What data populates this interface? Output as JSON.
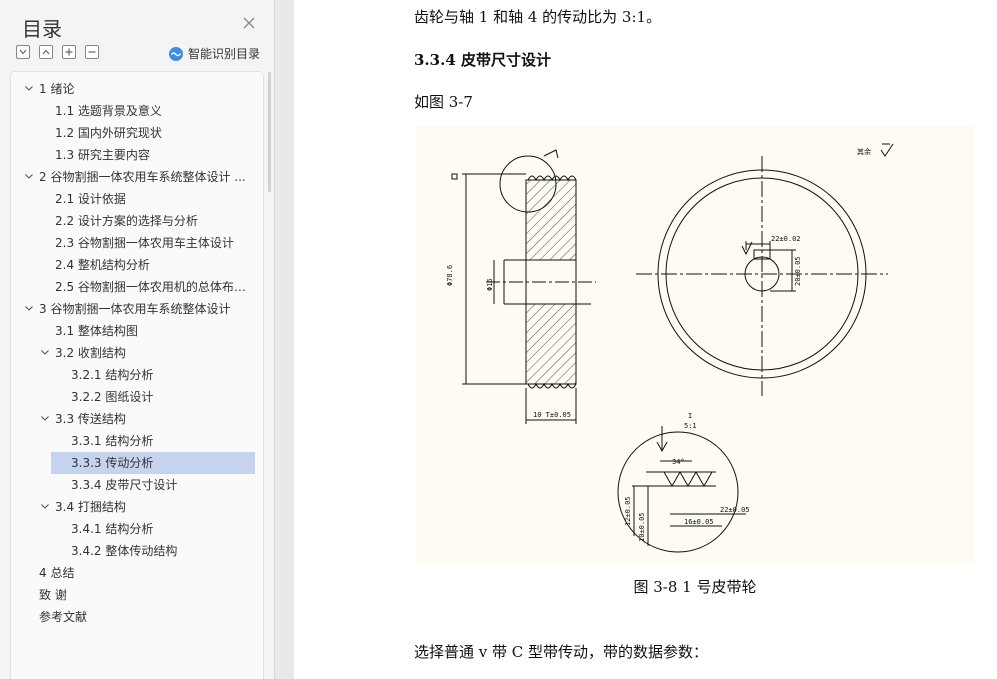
{
  "toc": {
    "title": "目录",
    "smart_label": "智能识别目录",
    "items": [
      {
        "label": "1 绪论",
        "level": 1,
        "chevron": true
      },
      {
        "label": "1.1 选题背景及意义",
        "level": 2,
        "chevron": false
      },
      {
        "label": "1.2 国内外研究现状",
        "level": 2,
        "chevron": false
      },
      {
        "label": "1.3 研究主要内容",
        "level": 2,
        "chevron": false
      },
      {
        "label": "2 谷物割捆一体农用车系统整体设计 ...",
        "level": 1,
        "chevron": true
      },
      {
        "label": "2.1 设计依据",
        "level": 2,
        "chevron": false
      },
      {
        "label": "2.2  设计方案的选择与分析",
        "level": 2,
        "chevron": false
      },
      {
        "label": "2.3 谷物割捆一体农用车主体设计",
        "level": 2,
        "chevron": false
      },
      {
        "label": "2.4 整机结构分析",
        "level": 2,
        "chevron": false
      },
      {
        "label": "2.5 谷物割捆一体农用机的总体布 ...",
        "level": 2,
        "chevron": false
      },
      {
        "label": "3 谷物割捆一体农用车系统整体设计",
        "level": 1,
        "chevron": true
      },
      {
        "label": "3.1 整体结构图",
        "level": 2,
        "chevron": false
      },
      {
        "label": "3.2 收割结构",
        "level": 2,
        "chevron": true
      },
      {
        "label": "3.2.1 结构分析",
        "level": 3,
        "chevron": false
      },
      {
        "label": "3.2.2 图纸设计",
        "level": 3,
        "chevron": false
      },
      {
        "label": "3.3 传送结构",
        "level": 2,
        "chevron": true
      },
      {
        "label": "3.3.1 结构分析",
        "level": 3,
        "chevron": false
      },
      {
        "label": "3.3.3 传动分析",
        "level": 3,
        "chevron": false,
        "selected": true
      },
      {
        "label": "3.3.4 皮带尺寸设计",
        "level": 3,
        "chevron": false
      },
      {
        "label": "3.4 打捆结构",
        "level": 2,
        "chevron": true
      },
      {
        "label": "3.4.1 结构分析",
        "level": 3,
        "chevron": false
      },
      {
        "label": "3.4.2 整体传动结构",
        "level": 3,
        "chevron": false
      },
      {
        "label": "4 总结",
        "level": 1,
        "chevron": false
      },
      {
        "label": "致    谢",
        "level": 1,
        "chevron": false
      },
      {
        "label": "参考文献",
        "level": 1,
        "chevron": false
      }
    ]
  },
  "doc": {
    "para_top": "齿轮与轴 1 和轴 4 的传动比为 3:1。",
    "heading": "3.3.4 皮带尺寸设计",
    "para_fig": "如图 3-7",
    "caption": "图 3-8 1 号皮带轮",
    "para_bottom": "选择普通 v 带 C 型带传动，带的数据参数："
  },
  "drawing": {
    "dim_diameter": "Φ78.6",
    "dim_bore": "Φ16",
    "dim_width": "10 T±0.05",
    "dim_key_width": "22±0.02",
    "dim_key_depth": "20±0.05",
    "detail_label_top": "I",
    "detail_label_scale": "5:1",
    "detail_angle": "34°",
    "dim_pitch_a": "22±0.05",
    "dim_pitch_b": "16±0.05",
    "dim_depth_a": "12±0.05",
    "dim_depth_b": "10±0.05",
    "roughness_note": "其余"
  },
  "colors": {
    "selection": "#c6d3ef",
    "smart_icon": "#3d8de8",
    "figure_bg": "#fdfbf2"
  }
}
